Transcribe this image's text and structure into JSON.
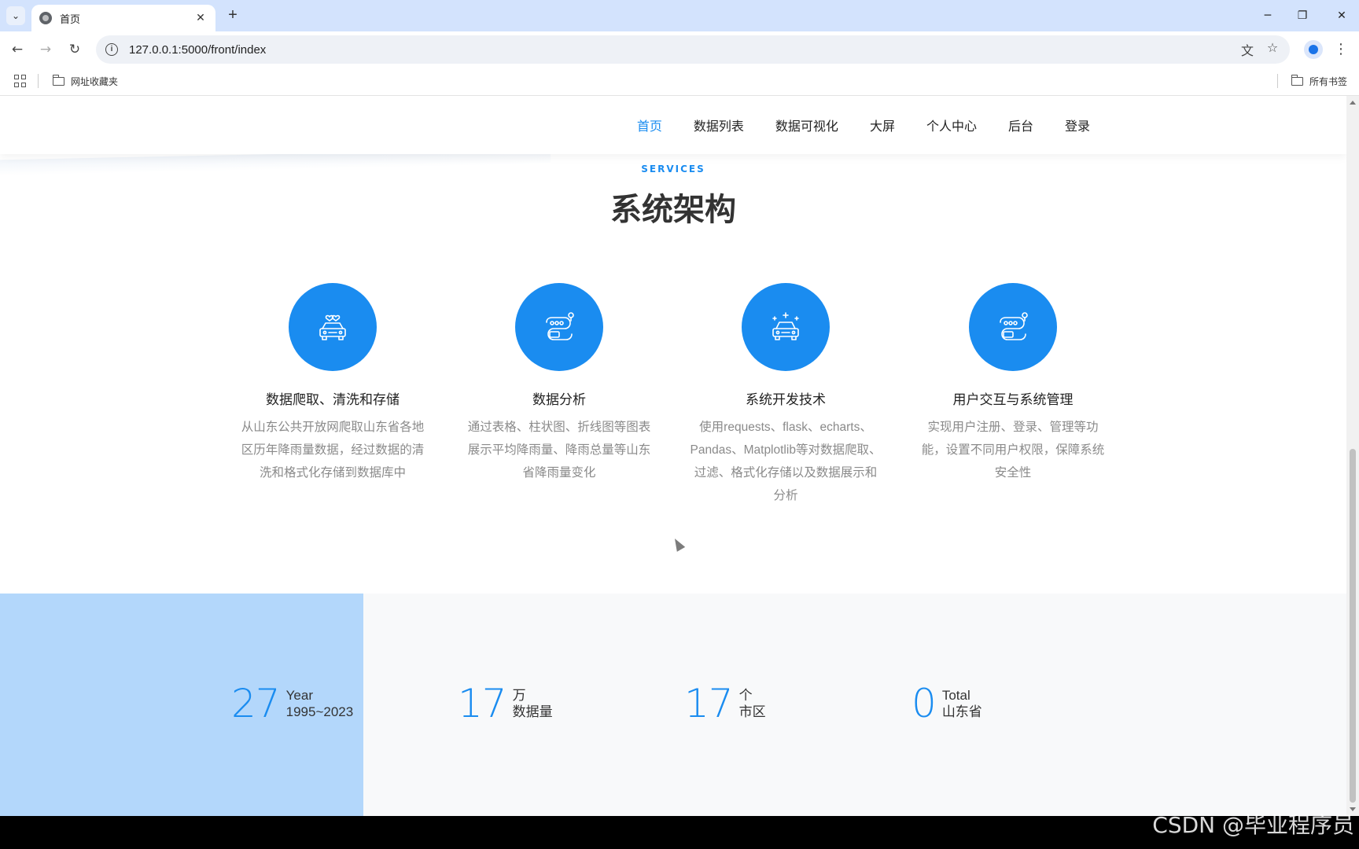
{
  "browser": {
    "tab_title": "首页",
    "url": "127.0.0.1:5000/front/index",
    "bookmark_folder": "网址收藏夹",
    "all_bookmarks": "所有书签"
  },
  "nav": {
    "items": [
      "首页",
      "数据列表",
      "数据可视化",
      "大屏",
      "个人中心",
      "后台",
      "登录"
    ],
    "active_index": 0
  },
  "services": {
    "eyebrow": "SERVICES",
    "title": "系统架构",
    "items": [
      {
        "title": "数据爬取、清洗和存储",
        "desc": "从山东公共开放网爬取山东省各地区历年降雨量数据，经过数据的清洗和格式化存储到数据库中",
        "icon": "car-heart-icon"
      },
      {
        "title": "数据分析",
        "desc": "通过表格、柱状图、折线图等图表展示平均降雨量、降雨总量等山东省降雨量变化",
        "icon": "route-road-icon"
      },
      {
        "title": "系统开发技术",
        "desc": "使用requests、flask、echarts、Pandas、Matplotlib等对数据爬取、过滤、格式化存储以及数据展示和分析",
        "icon": "car-sparkle-icon"
      },
      {
        "title": "用户交互与系统管理",
        "desc": "实现用户注册、登录、管理等功能，设置不同用户权限，保障系统安全性",
        "icon": "route-road-icon"
      }
    ]
  },
  "stats": [
    {
      "num": "27",
      "line1": "Year",
      "line2": "1995~2023"
    },
    {
      "num": "17",
      "line1": "万",
      "line2": "数据量"
    },
    {
      "num": "17",
      "line1": "个",
      "line2": "市区"
    },
    {
      "num": "0",
      "line1": "Total",
      "line2": "山东省"
    }
  ],
  "watermark": "CSDN @毕业程序员",
  "colors": {
    "accent": "#1a8cf0",
    "stats_left": "#b3d7fb",
    "stats_bg": "#f8f9fa",
    "tabbar": "#d3e3fd"
  }
}
